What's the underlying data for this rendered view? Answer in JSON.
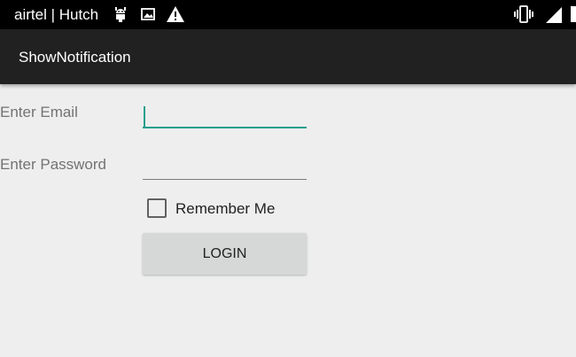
{
  "status_bar": {
    "carrier": "airtel | Hutch",
    "icons": [
      "android-debug-icon",
      "image-icon",
      "warning-icon",
      "vibrate-icon",
      "signal-icon",
      "battery-icon"
    ]
  },
  "app_bar": {
    "title": "ShowNotification"
  },
  "form": {
    "email_label": "Enter Email",
    "email_value": "",
    "password_label": "Enter Password",
    "password_value": "",
    "remember_label": "Remember Me",
    "remember_checked": false,
    "login_label": "LOGIN"
  },
  "colors": {
    "accent": "#1e9e8c",
    "background": "#eeeeee",
    "app_bar": "#212121",
    "status_bar": "#000000",
    "button": "#d6d7d7"
  }
}
